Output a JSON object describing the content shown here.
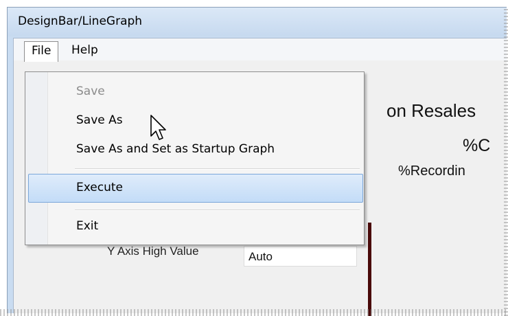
{
  "window": {
    "title": "DesignBar/LineGraph"
  },
  "menubar": {
    "file": "File",
    "help": "Help"
  },
  "file_menu": {
    "save": "Save",
    "save_as": "Save As",
    "save_as_startup": "Save As and Set as Startup Graph",
    "execute": "Execute",
    "exit": "Exit"
  },
  "background": {
    "chart_title_partial": "on Resales",
    "series_c_partial": "%C",
    "series_recording_partial": "%Recordin",
    "y_axis_high_label": "Y Axis High Value",
    "y_axis_high_value": "Auto"
  },
  "colors": {
    "highlight": "#c3dcf7",
    "menu_background": "#f5f5f5",
    "title_bar": "#c9dcf1"
  }
}
